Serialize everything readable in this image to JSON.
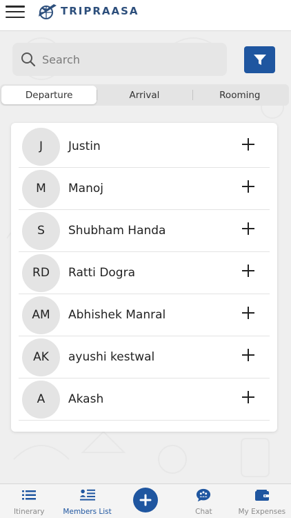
{
  "header": {
    "brand": "TRIPRAASA"
  },
  "search": {
    "placeholder": "Search"
  },
  "tabs": [
    {
      "label": "Departure",
      "active": true
    },
    {
      "label": "Arrival",
      "active": false
    },
    {
      "label": "Rooming",
      "active": false
    }
  ],
  "members": [
    {
      "initials": "J",
      "name": "Justin"
    },
    {
      "initials": "M",
      "name": "Manoj"
    },
    {
      "initials": "S",
      "name": "Shubham Handa"
    },
    {
      "initials": "RD",
      "name": "Ratti Dogra"
    },
    {
      "initials": "AM",
      "name": "Abhishek Manral"
    },
    {
      "initials": "AK",
      "name": "ayushi kestwal"
    },
    {
      "initials": "A",
      "name": "Akash"
    }
  ],
  "bottom_nav": [
    {
      "label": "Itinerary",
      "icon": "list-icon"
    },
    {
      "label": "Members List",
      "icon": "members-list-icon",
      "active": true
    },
    {
      "label": "",
      "icon": "add-icon"
    },
    {
      "label": "Chat",
      "icon": "chat-icon"
    },
    {
      "label": "My Expenses",
      "icon": "wallet-icon"
    }
  ],
  "colors": {
    "primary": "#1f56a0",
    "brand_text": "#2d4f7c",
    "avatar_bg": "#e4e4e4"
  }
}
